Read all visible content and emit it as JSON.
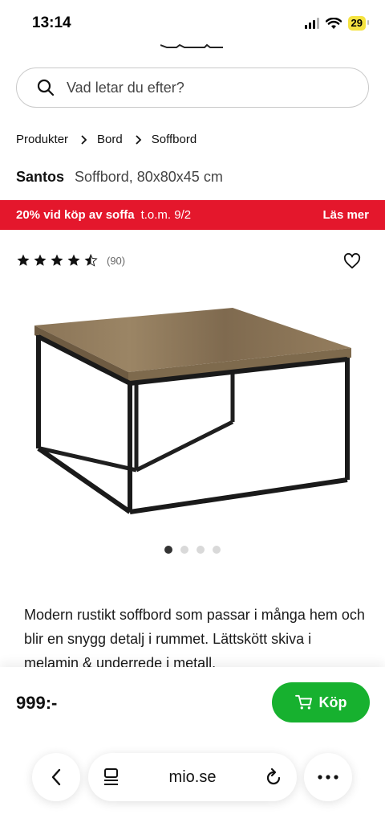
{
  "status_bar": {
    "time": "13:14",
    "battery": "29"
  },
  "search": {
    "placeholder": "Vad letar du efter?"
  },
  "breadcrumb": [
    "Produkter",
    "Bord",
    "Soffbord"
  ],
  "product": {
    "name": "Santos",
    "description": "Soffbord, 80x80x45 cm"
  },
  "promo": {
    "text": "20% vid köp av soffa",
    "date": "t.o.m. 9/2",
    "link": "Läs mer",
    "color": "#e4172c"
  },
  "rating": {
    "stars": 4.5,
    "max": 5,
    "count": "(90)"
  },
  "gallery": {
    "image_count": 4,
    "active_index": 0
  },
  "details": {
    "text": "Modern rustikt soffbord som passar i många hem och blir en snygg detalj i rummet. Lättskött skiva i melamin & underrede i metall."
  },
  "purchase": {
    "price": "999:-",
    "buy_label": "Köp",
    "buy_color": "#17b12f"
  },
  "browser": {
    "url": "mio.se"
  },
  "icons": [
    "search-icon",
    "chevron-right-icon",
    "star-icon",
    "half-star-icon",
    "heart-icon",
    "cart-icon",
    "back-icon",
    "reader-icon",
    "reload-icon",
    "more-icon"
  ]
}
